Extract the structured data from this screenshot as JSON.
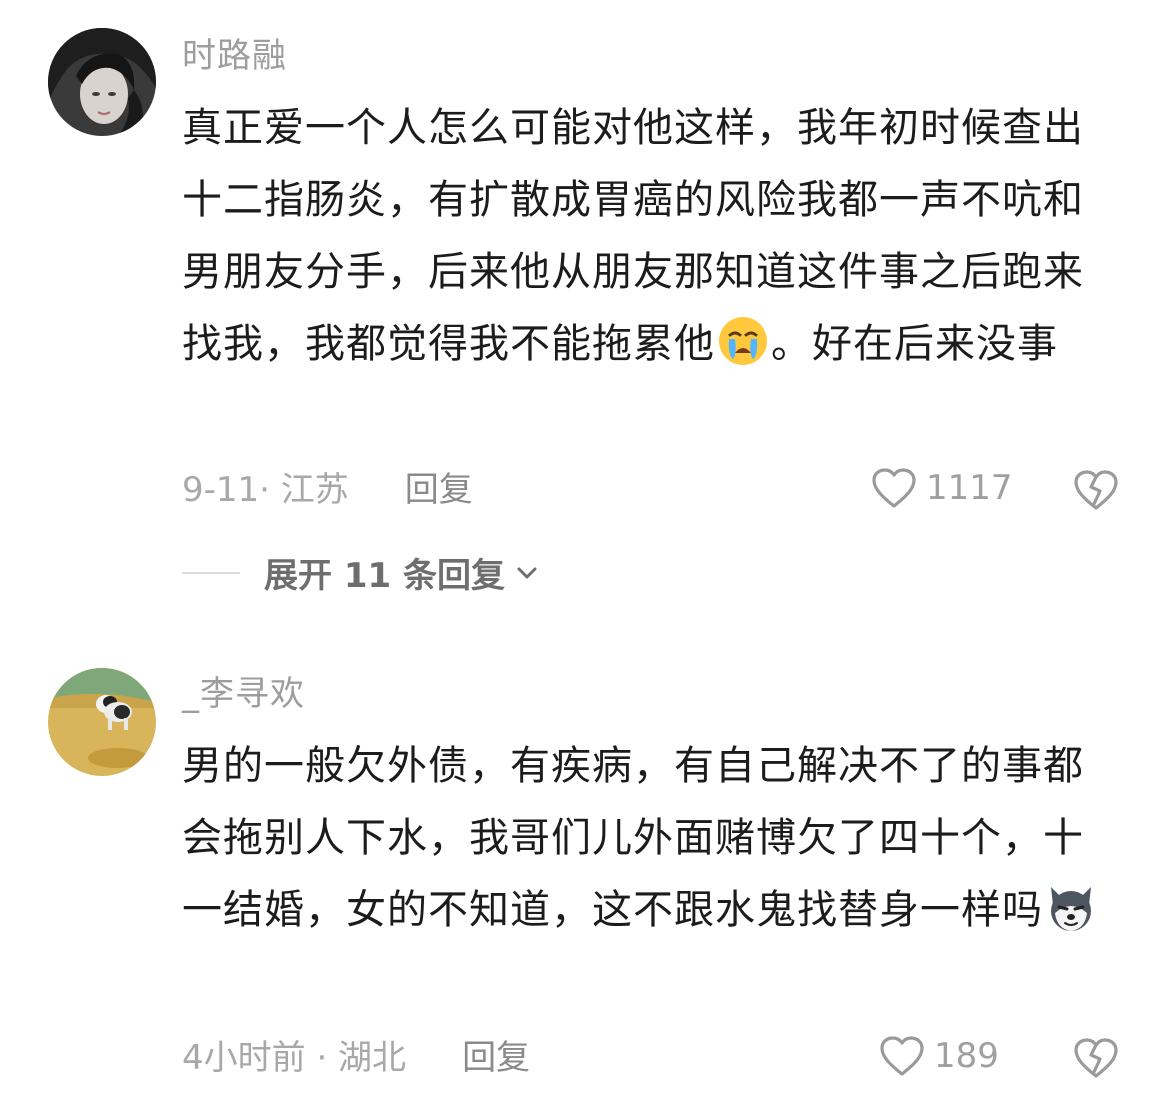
{
  "comments": [
    {
      "username": "时路融",
      "text_before_emoji": "真正爱一个人怎么可能对他这样，我年初时候查出十二指肠炎，有扩散成胃癌的风险我都一声不吭和男朋友分手，后来他从朋友那知道这件事之后跑来找我，我都觉得我不能拖累他",
      "text_after_emoji": "。好在后来没事",
      "emoji_icon": "crying-face-icon",
      "date_location": "9-11· 江苏",
      "reply_label": "回复",
      "likes": "1117",
      "expand_label": "展开 11 条回复"
    },
    {
      "username": "_李寻欢",
      "text_before_emoji": "男的一般欠外债，有疾病，有自己解决不了的事都会拖别人下水，我哥们儿外面赌博欠了四十个，十一结婚，女的不知道，这不跟水鬼找替身一样吗",
      "text_after_emoji": "",
      "emoji_icon": "husky-face-icon",
      "date_location": "4小时前 · 湖北",
      "reply_label": "回复",
      "likes": "189"
    }
  ],
  "colors": {
    "username": "#9d9d9d",
    "body": "#1c1c1c",
    "meta": "#a8a8a8",
    "background": "#ffffff"
  }
}
